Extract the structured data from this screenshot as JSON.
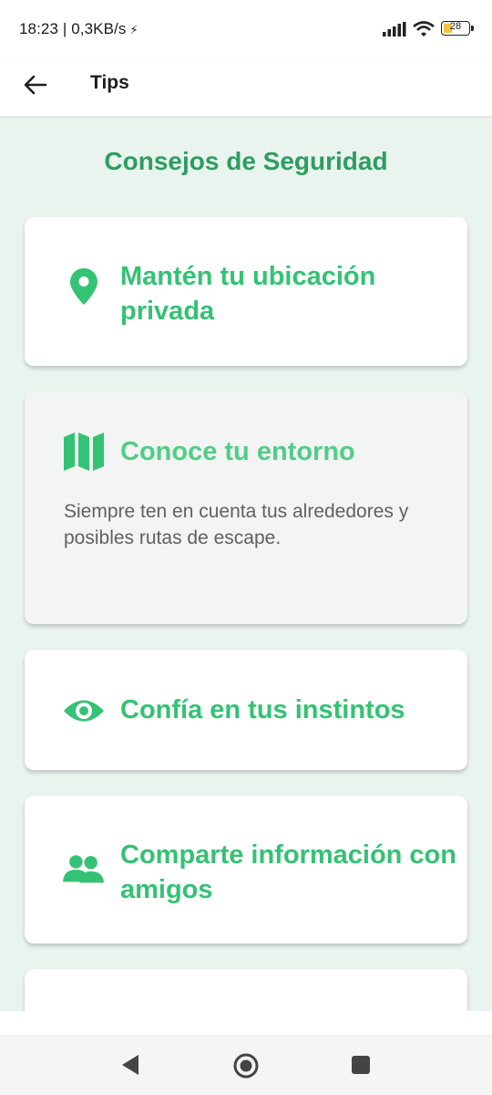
{
  "status_bar": {
    "time_speed": "18:23 | 0,3KB/s",
    "battery_level": "28",
    "icons": [
      "bolt-icon",
      "signal-icon",
      "wifi-icon",
      "battery-icon"
    ]
  },
  "app_bar": {
    "title": "Tips",
    "back_icon": "arrow-left-icon"
  },
  "content": {
    "section_title": "Consejos de Seguridad",
    "cards": [
      {
        "icon": "location-pin-icon",
        "title_line1": "Mantén tu ubicación",
        "title_line2": "privada"
      },
      {
        "icon": "map-icon",
        "title": "Conoce tu entorno",
        "description": "Siempre ten en cuenta tus alrededores y posibles rutas de escape.",
        "expanded": true
      },
      {
        "icon": "eye-icon",
        "title": "Confía en tus instintos"
      },
      {
        "icon": "people-icon",
        "title_line1": "Comparte información con",
        "title_line2": "amigos"
      }
    ]
  },
  "colors": {
    "accent_green": "#34c274",
    "heading_green": "#2e9d62",
    "background_mint": "#e9f4ee",
    "card_white": "#ffffff"
  },
  "nav_bar": {
    "icons": [
      "back-triangle-icon",
      "home-circle-icon",
      "recents-square-icon"
    ]
  }
}
